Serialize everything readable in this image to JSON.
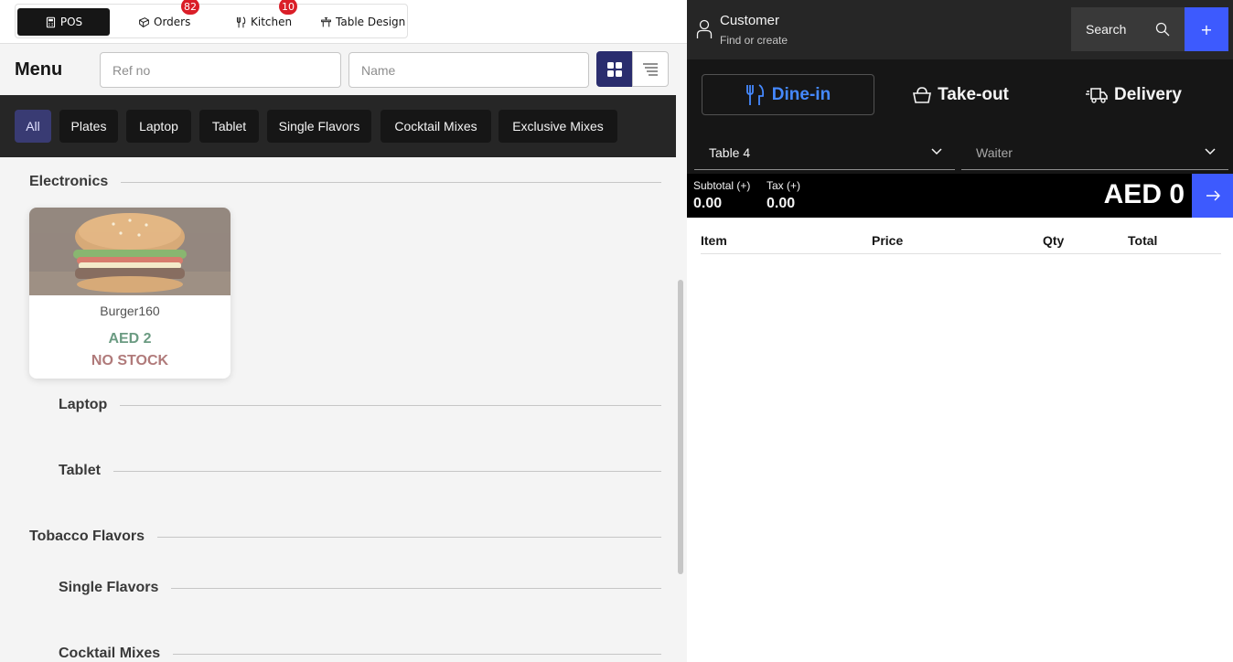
{
  "nav": {
    "pos": "POS",
    "orders": "Orders",
    "orders_badge": "82",
    "kitchen": "Kitchen",
    "kitchen_badge": "10",
    "table_design": "Table Design"
  },
  "menu": {
    "title": "Menu",
    "ref_placeholder": "Ref no",
    "name_placeholder": "Name",
    "view_modes": [
      "grid-icon",
      "list-icon"
    ]
  },
  "categories": [
    "All",
    "Plates",
    "Laptop",
    "Tablet",
    "Single Flavors",
    "Cocktail Mixes",
    "Exclusive Mixes"
  ],
  "active_category": "All",
  "sections": {
    "electronics": "Electronics",
    "laptop": "Laptop",
    "tablet": "Tablet",
    "tobacco": "Tobacco Flavors",
    "single": "Single Flavors",
    "cocktail": "Cocktail Mixes"
  },
  "product": {
    "name": "Burger160",
    "price": "AED 2",
    "stock": "NO STOCK",
    "image": "burger-photo"
  },
  "customer": {
    "title": "Customer",
    "subtitle": "Find or create",
    "search_label": "Search",
    "add_label": "+"
  },
  "order_types": {
    "dine_in": "Dine-in",
    "take_out": "Take-out",
    "delivery": "Delivery",
    "selected": "Dine-in"
  },
  "selects": {
    "table": "Table 4",
    "waiter": "Waiter"
  },
  "totals": {
    "subtotal_label": "Subtotal (+)",
    "subtotal_value": "0.00",
    "tax_label": "Tax (+)",
    "tax_value": "0.00",
    "grand_total": "AED 0"
  },
  "items_table": {
    "headers": [
      "Item",
      "Price",
      "Qty",
      "Total"
    ],
    "rows": []
  },
  "colors": {
    "accent_blue": "#3d5afe",
    "dine_in_blue": "#4589ff",
    "badge_red": "#da1e28",
    "price_green": "#6b9b82",
    "stock_red": "#b07a7a"
  }
}
